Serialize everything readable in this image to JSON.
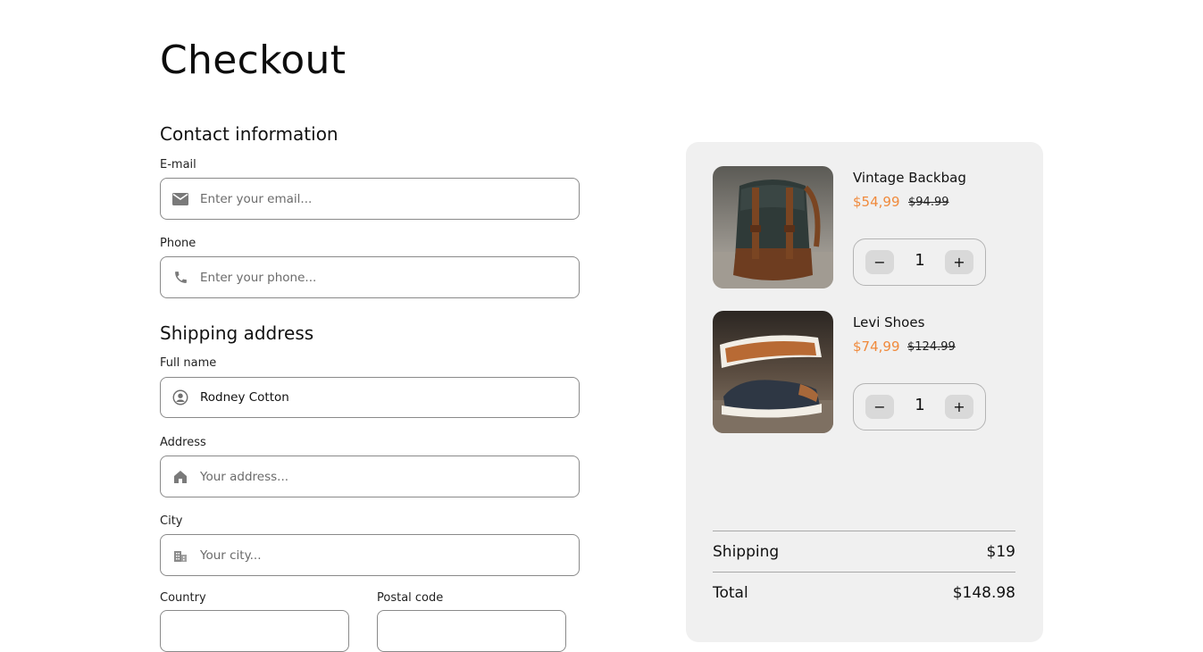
{
  "page": {
    "title": "Checkout"
  },
  "contact": {
    "section_title": "Contact information",
    "email": {
      "label": "E-mail",
      "placeholder": "Enter your email...",
      "value": "",
      "icon": "mail-icon"
    },
    "phone": {
      "label": "Phone",
      "placeholder": "Enter your phone...",
      "value": "",
      "icon": "phone-icon"
    }
  },
  "shipping": {
    "section_title": "Shipping address",
    "full_name": {
      "label": "Full name",
      "placeholder": "",
      "value": "Rodney Cotton",
      "icon": "user-circle-icon"
    },
    "address": {
      "label": "Address",
      "placeholder": "Your address...",
      "value": "",
      "icon": "home-icon"
    },
    "city": {
      "label": "City",
      "placeholder": "Your city...",
      "value": "",
      "icon": "city-icon"
    },
    "country": {
      "label": "Country"
    },
    "postal_code": {
      "label": "Postal code"
    }
  },
  "cart": {
    "items": [
      {
        "name": "Vintage Backbag",
        "price": "$54,99",
        "old_price": "$94.99",
        "quantity": "1",
        "decrement": "−",
        "increment": "+"
      },
      {
        "name": "Levi Shoes",
        "price": "$74,99",
        "old_price": "$124.99",
        "quantity": "1",
        "decrement": "−",
        "increment": "+"
      }
    ],
    "shipping": {
      "label": "Shipping",
      "value": "$19"
    },
    "total": {
      "label": "Total",
      "value": "$148.98"
    }
  },
  "colors": {
    "accent_price": "#f08a3c",
    "panel_bg": "#f0f0f0",
    "border": "#8a8a8a"
  }
}
